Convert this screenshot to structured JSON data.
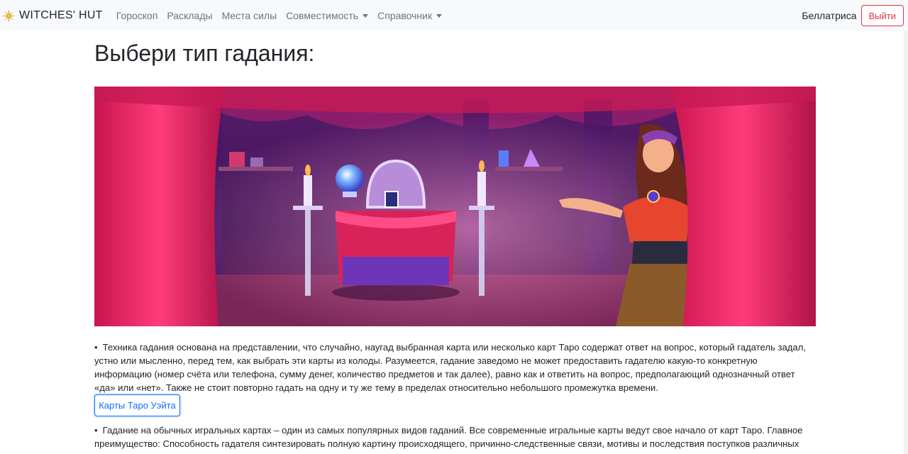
{
  "navbar": {
    "brand": "WITCHES' HUT",
    "brand_icon": "sun-icon",
    "links": [
      {
        "label": "Гороскоп",
        "dropdown": false
      },
      {
        "label": "Расклады",
        "dropdown": false
      },
      {
        "label": "Места силы",
        "dropdown": false
      },
      {
        "label": "Совместимость",
        "dropdown": true
      },
      {
        "label": "Справочник",
        "dropdown": true
      }
    ],
    "username": "Беллатриса",
    "logout_label": "Выйти"
  },
  "main": {
    "title": "Выбери тип гадания:",
    "sections": [
      {
        "bullet": "•",
        "text": "Техника гадания основана на представлении, что случайно, наугад выбранная карта или несколько карт Таро содержат ответ на вопрос, который гадатель задал, устно или мысленно, перед тем, как выбрать эти карты из колоды. Разумеется, гадание заведомо не может предоставить гадателю какую-то конкретную информацию (номер счёта или телефона, сумму денег, количество предметов и так далее), равно как и ответить на вопрос, предполагающий однозначный ответ «да» или «нет». Также не стоит повторно гадать на одну и ту же тему в пределах относительно небольшого промежутка времени.",
        "button_label": "Карты Таро Уэйта"
      },
      {
        "bullet": "•",
        "text": "Гадание на обычных игральных картах – один из самых популярных видов гаданий. Все современные игральные карты ведут свое начало от карт Таро. Главное преимущество: Способность гадателя синтезировать полную картину происходящего, причинно-следственные связи, мотивы и последствия поступков различных"
      }
    ]
  },
  "colors": {
    "accent": "#0d6efd",
    "danger": "#dc3545",
    "navbar_bg": "#f8f9fa"
  }
}
